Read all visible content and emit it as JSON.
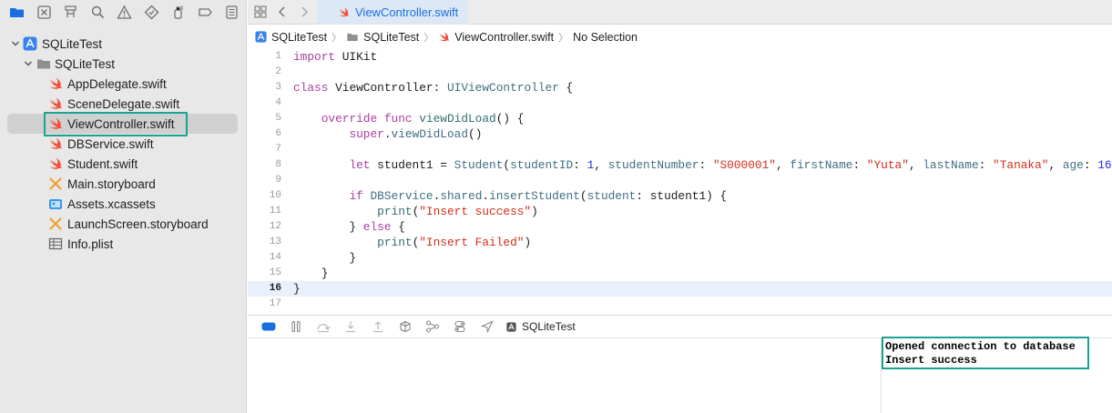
{
  "editor": {
    "tab_label": "ViewController.swift",
    "breadcrumb": [
      "SQLiteTest",
      "SQLiteTest",
      "ViewController.swift",
      "No Selection"
    ]
  },
  "navigator": {
    "items": [
      {
        "label": "SQLiteTest",
        "icon": "app-project-icon",
        "level": 0,
        "expanded": true
      },
      {
        "label": "SQLiteTest",
        "icon": "folder-icon",
        "level": 1,
        "expanded": true
      },
      {
        "label": "AppDelegate.swift",
        "icon": "swift-file-icon",
        "level": 2
      },
      {
        "label": "SceneDelegate.swift",
        "icon": "swift-file-icon",
        "level": 2
      },
      {
        "label": "ViewController.swift",
        "icon": "swift-file-icon",
        "level": 2,
        "selected": true
      },
      {
        "label": "DBService.swift",
        "icon": "swift-file-icon",
        "level": 2
      },
      {
        "label": "Student.swift",
        "icon": "swift-file-icon",
        "level": 2
      },
      {
        "label": "Main.storyboard",
        "icon": "storyboard-icon",
        "level": 2
      },
      {
        "label": "Assets.xcassets",
        "icon": "assets-icon",
        "level": 2
      },
      {
        "label": "LaunchScreen.storyboard",
        "icon": "storyboard-icon",
        "level": 2
      },
      {
        "label": "Info.plist",
        "icon": "plist-icon",
        "level": 2
      }
    ]
  },
  "code": {
    "current_line": 16,
    "lines": [
      {
        "n": "1",
        "t": [
          [
            "kw",
            "import"
          ],
          [
            "pl",
            " UIKit"
          ]
        ]
      },
      {
        "n": "2",
        "t": []
      },
      {
        "n": "3",
        "t": [
          [
            "kw",
            "class"
          ],
          [
            "pl",
            " ViewController: "
          ],
          [
            "ty",
            "UIViewController"
          ],
          [
            "pl",
            " {"
          ]
        ]
      },
      {
        "n": "4",
        "t": []
      },
      {
        "n": "5",
        "t": [
          [
            "pl",
            "    "
          ],
          [
            "kw",
            "override func"
          ],
          [
            "pl",
            " "
          ],
          [
            "fn",
            "viewDidLoad"
          ],
          [
            "pl",
            "() {"
          ]
        ]
      },
      {
        "n": "6",
        "t": [
          [
            "pl",
            "        "
          ],
          [
            "kw",
            "super"
          ],
          [
            "pl",
            "."
          ],
          [
            "ty",
            "viewDidLoad"
          ],
          [
            "pl",
            "()"
          ]
        ]
      },
      {
        "n": "7",
        "t": []
      },
      {
        "n": "8",
        "t": [
          [
            "pl",
            "        "
          ],
          [
            "kw",
            "let"
          ],
          [
            "pl",
            " student1 = "
          ],
          [
            "ty",
            "Student"
          ],
          [
            "pl",
            "("
          ],
          [
            "pa",
            "studentID"
          ],
          [
            "pl",
            ": "
          ],
          [
            "nm",
            "1"
          ],
          [
            "pl",
            ", "
          ],
          [
            "pa",
            "studentNumber"
          ],
          [
            "pl",
            ": "
          ],
          [
            "st",
            "\"S000001\""
          ],
          [
            "pl",
            ", "
          ],
          [
            "pa",
            "firstName"
          ],
          [
            "pl",
            ": "
          ],
          [
            "st",
            "\"Yuta\""
          ],
          [
            "pl",
            ", "
          ],
          [
            "pa",
            "lastName"
          ],
          [
            "pl",
            ": "
          ],
          [
            "st",
            "\"Tanaka\""
          ],
          [
            "pl",
            ", "
          ],
          [
            "pa",
            "age"
          ],
          [
            "pl",
            ": "
          ],
          [
            "nm",
            "16"
          ],
          [
            "pl",
            ")"
          ]
        ]
      },
      {
        "n": "9",
        "t": []
      },
      {
        "n": "10",
        "t": [
          [
            "pl",
            "        "
          ],
          [
            "kw",
            "if"
          ],
          [
            "pl",
            " "
          ],
          [
            "ty",
            "DBService"
          ],
          [
            "pl",
            "."
          ],
          [
            "ty",
            "shared"
          ],
          [
            "pl",
            "."
          ],
          [
            "ty",
            "insertStudent"
          ],
          [
            "pl",
            "("
          ],
          [
            "pa",
            "student"
          ],
          [
            "pl",
            ": student1) {"
          ]
        ]
      },
      {
        "n": "11",
        "t": [
          [
            "pl",
            "            "
          ],
          [
            "fn",
            "print"
          ],
          [
            "pl",
            "("
          ],
          [
            "st",
            "\"Insert success\""
          ],
          [
            "pl",
            ")"
          ]
        ]
      },
      {
        "n": "12",
        "t": [
          [
            "pl",
            "        } "
          ],
          [
            "kw",
            "else"
          ],
          [
            "pl",
            " {"
          ]
        ]
      },
      {
        "n": "13",
        "t": [
          [
            "pl",
            "            "
          ],
          [
            "fn",
            "print"
          ],
          [
            "pl",
            "("
          ],
          [
            "st",
            "\"Insert Failed\""
          ],
          [
            "pl",
            ")"
          ]
        ]
      },
      {
        "n": "14",
        "t": [
          [
            "pl",
            "        }"
          ]
        ]
      },
      {
        "n": "15",
        "t": [
          [
            "pl",
            "    }"
          ]
        ]
      },
      {
        "n": "16",
        "t": [
          [
            "pl",
            "}"
          ]
        ]
      },
      {
        "n": "17",
        "t": []
      }
    ]
  },
  "debug": {
    "scheme_label": "SQLiteTest"
  },
  "console": {
    "lines": [
      "Opened connection to database",
      "Insert success"
    ]
  },
  "colors": {
    "accent": "#1a6fe0",
    "highlight_box": "#1aa391",
    "swift_orange": "#f05138"
  }
}
